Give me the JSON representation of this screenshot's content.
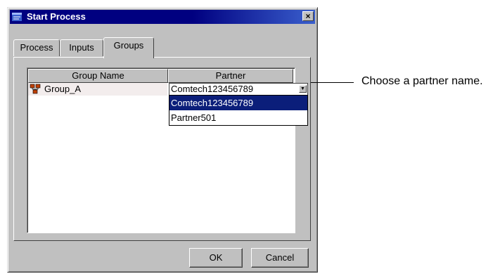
{
  "window": {
    "title": "Start Process",
    "close_label": "×"
  },
  "tabs": [
    {
      "label": "Process",
      "active": false
    },
    {
      "label": "Inputs",
      "active": false
    },
    {
      "label": "Groups",
      "active": true
    }
  ],
  "table": {
    "columns": [
      "Group Name",
      "Partner"
    ],
    "rows": [
      {
        "group_name": "Group_A",
        "partner": "Comtech123456789"
      }
    ]
  },
  "partner_dropdown": {
    "options": [
      "Comtech123456789",
      "Partner501"
    ],
    "selected": "Comtech123456789"
  },
  "buttons": {
    "ok": "OK",
    "cancel": "Cancel"
  },
  "callout": "Choose a partner name.",
  "colors": {
    "titlebar": "#000080",
    "selection": "#0b1e7a",
    "dialog_bg": "#c0c0c0"
  }
}
